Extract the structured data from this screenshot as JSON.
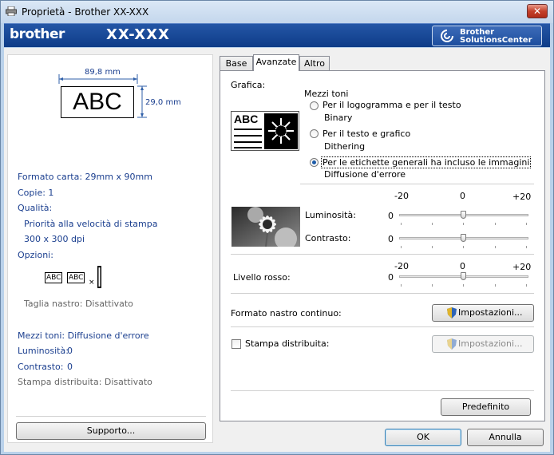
{
  "window": {
    "title": "Proprietà - Brother  XX-XXX",
    "close_glyph": "✕"
  },
  "brand": {
    "logo": "brother",
    "model": "XX-XXX",
    "solutions_center": "Brother\nSolutionsCenter"
  },
  "preview": {
    "label_text": "ABC",
    "width": "89,8 mm",
    "height": "29,0 mm"
  },
  "summary": {
    "paper": "Formato carta: 29mm x 90mm",
    "copies": "Copie: 1",
    "quality_label": "Qualità:",
    "quality_value": "Priorità alla velocità di stampa",
    "resolution": "300 x 300 dpi",
    "options_label": "Opzioni:",
    "option_tag1": "ABC",
    "option_tag2": "ABC",
    "cut": "Taglia nastro: Disattivato",
    "halftone": "Mezzi toni: Diffusione d'errore",
    "brightness_label": "Luminosità:",
    "brightness_value": "0",
    "contrast_label": "Contrasto:",
    "contrast_value": "0",
    "distributed": "Stampa distribuita: Disattivato"
  },
  "support_button": "Supporto...",
  "tabs": [
    "Base",
    "Avanzate",
    "Altro"
  ],
  "advanced": {
    "graphics_label": "Grafica:",
    "halftone_group": "Mezzi toni",
    "thumb_text": "ABC",
    "options": [
      {
        "line1": "Per il logogramma e per il testo",
        "line2": "Binary",
        "selected": false
      },
      {
        "line1": "Per il testo e grafico",
        "line2": "Dithering",
        "selected": false
      },
      {
        "line1": "Per le etichette generali ha incluso le immagini",
        "line2": "Diffusione d'errore",
        "selected": true
      }
    ],
    "scale_min": "-20",
    "scale_mid": "0",
    "scale_max": "+20",
    "brightness": {
      "label": "Luminosità:",
      "value": "0"
    },
    "contrast": {
      "label": "Contrasto:",
      "value": "0"
    },
    "red_level": {
      "label": "Livello rosso:",
      "value": "0"
    },
    "continuous_tape": "Formato nastro continuo:",
    "settings_button": "Impostazioni...",
    "distributed_print": "Stampa distribuita:",
    "distributed_checked": false,
    "settings_button_disabled": "Impostazioni...",
    "default_button": "Predefinito"
  },
  "footer": {
    "ok": "OK",
    "cancel": "Annulla"
  }
}
